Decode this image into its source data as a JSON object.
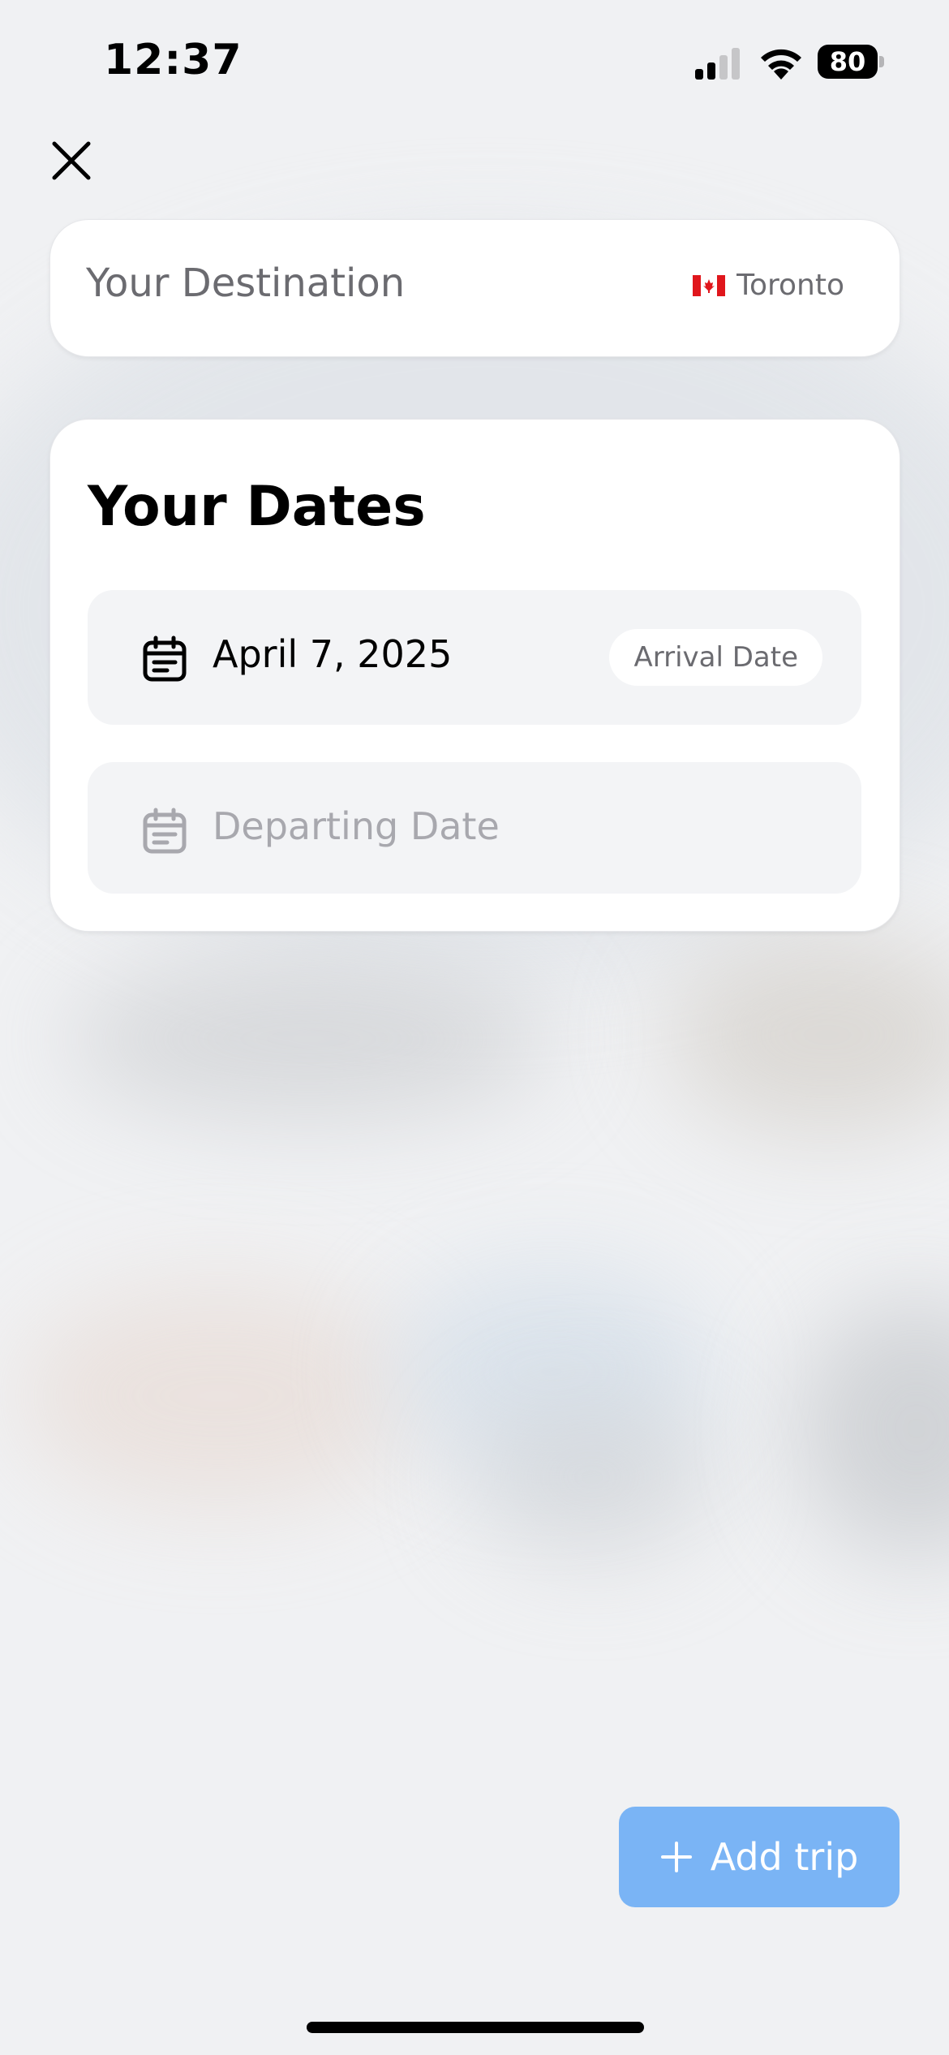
{
  "status_bar": {
    "time": "12:37",
    "battery": "80"
  },
  "close_button": {
    "icon": "close-icon"
  },
  "destination": {
    "label": "Your Destination",
    "flag": "canada-flag-icon",
    "city": "Toronto"
  },
  "dates": {
    "title": "Your Dates",
    "arrival": {
      "icon": "calendar-icon",
      "value": "April 7, 2025",
      "tag": "Arrival Date"
    },
    "departing": {
      "icon": "calendar-icon",
      "placeholder": "Departing Date"
    }
  },
  "add_trip": {
    "icon": "plus-icon",
    "label": "Add trip",
    "color": "#7ab4f5"
  }
}
